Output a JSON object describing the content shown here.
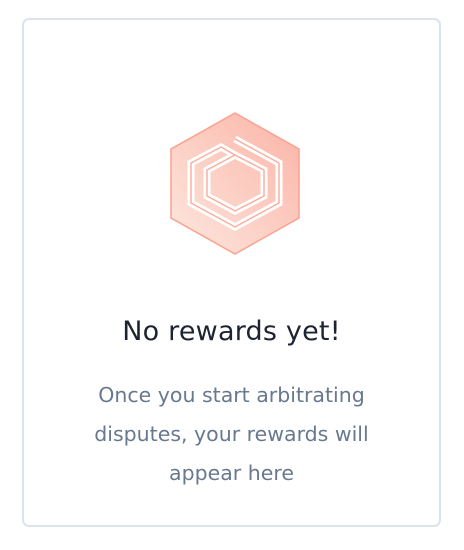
{
  "empty_state": {
    "title": "No rewards yet!",
    "description": "Once you start arbitrating disputes, your rewards will appear here",
    "icon": "aragon-court-logo-icon",
    "colors": {
      "icon_light": "#fde4da",
      "icon_dark": "#fbb1a3",
      "icon_stroke": "#f9a28e",
      "title": "#1d2330",
      "description": "#68788f",
      "border": "#dde3ea"
    }
  }
}
